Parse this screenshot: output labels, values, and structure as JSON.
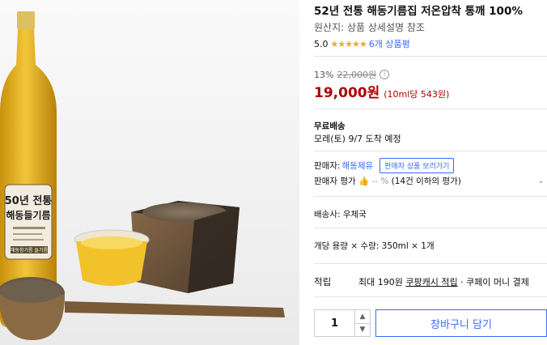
{
  "product": {
    "title": "52년 전통 해동기름집 저온압착 통깨 100%",
    "origin": "원산지: 상품 상세설명 참조",
    "rating_value": "5.0",
    "stars": "★★★★★",
    "review_count": "6개 상품평"
  },
  "price": {
    "discount_pct": "13%",
    "original": "22,000원",
    "info_icon": "ⓘ",
    "current": "19,000원",
    "unit_price": "(10ml당 543원)"
  },
  "shipping": {
    "title": "무료배송",
    "date": "모레(토) 9/7 도착 예정"
  },
  "seller": {
    "label": "판매자:",
    "name": "해동제유",
    "tooltip": "판매자 상품 보러가기",
    "rating_label": "판매자 평가",
    "rating_value": "-- %",
    "rating_note": "(14건 이하의 평가)"
  },
  "delivery": "배송사: 우체국",
  "quantity_line": "개당 용량 × 수량: 350ml × 1개",
  "reward": {
    "label": "적립",
    "prefix": "최대 190원",
    "link": "쿠팡캐시 적립",
    "suffix": " · 쿠페이 머니 결제"
  },
  "cart": {
    "quantity": "1",
    "up": "▲",
    "down": "▼",
    "button": "장바구니 담기"
  },
  "photo": {
    "bottle_label_line1": "50년 전통",
    "bottle_label_line2": "해동들기름",
    "bottle_brand": "해동참기름 들기름"
  },
  "colors": {
    "price_red": "#ae0000",
    "link_blue": "#346aff",
    "star_yellow": "#f5a623",
    "oil_gold": "#e8b81a"
  }
}
